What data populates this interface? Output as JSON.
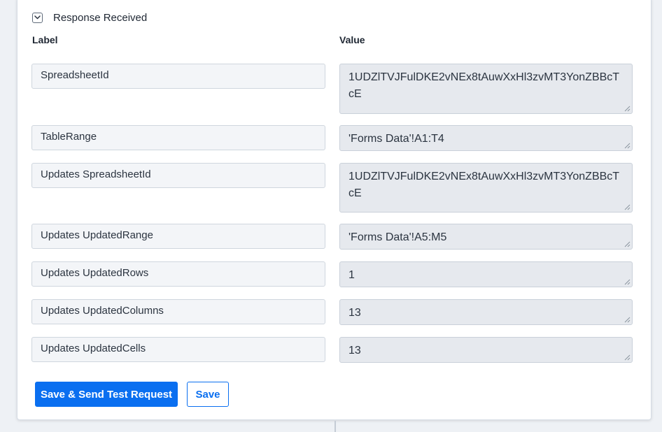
{
  "section": {
    "title": "Response Received",
    "toggle_icon": "chevron-down-icon"
  },
  "columns": {
    "label": "Label",
    "value": "Value"
  },
  "rows": [
    {
      "label": "SpreadsheetId",
      "value": "1UDZlTVJFulDKE2vNEx8tAuwXxHl3zvMT3YonZBBcTcE"
    },
    {
      "label": "TableRange",
      "value": "'Forms Data'!A1:T4"
    },
    {
      "label": "Updates SpreadsheetId",
      "value": "1UDZlTVJFulDKE2vNEx8tAuwXxHl3zvMT3YonZBBcTcE"
    },
    {
      "label": "Updates UpdatedRange",
      "value": "'Forms Data'!A5:M5"
    },
    {
      "label": "Updates UpdatedRows",
      "value": "1"
    },
    {
      "label": "Updates UpdatedColumns",
      "value": "13"
    },
    {
      "label": "Updates UpdatedCells",
      "value": "13"
    }
  ],
  "actions": {
    "primary_label": "Save & Send Test Request",
    "secondary_label": "Save"
  },
  "colors": {
    "accent": "#0a6ff0",
    "label_bg": "#f3f5f8",
    "value_bg": "#e6e9ee"
  }
}
